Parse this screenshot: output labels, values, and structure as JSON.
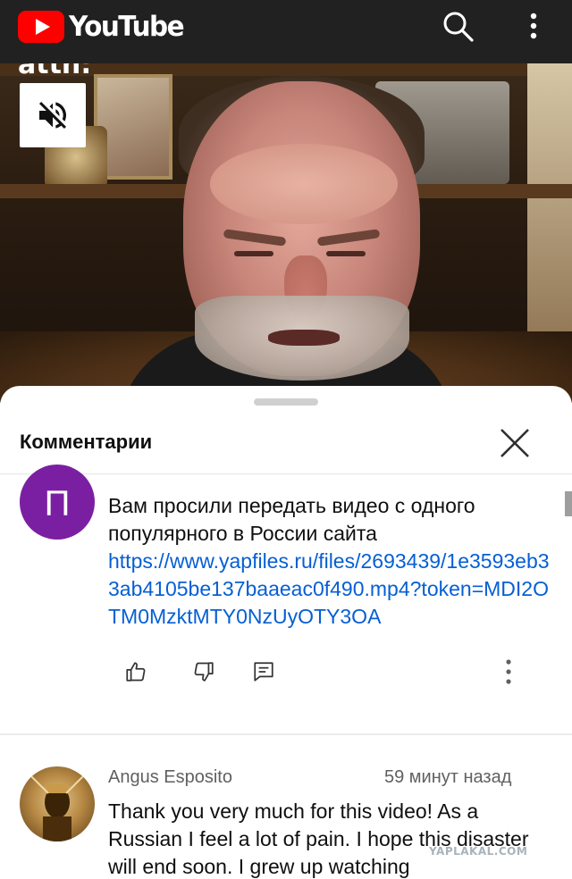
{
  "app": {
    "wordmark": "YouTube",
    "logo_icon": "youtube-play-logo",
    "search_icon": "search-icon",
    "more_icon": "more-vert-icon",
    "bar_color": "#212121",
    "brand_red": "#ff0000"
  },
  "video": {
    "channel_watermark": "attn:",
    "mute_icon": "volume-off-icon"
  },
  "comments_panel": {
    "title": "Комментарии",
    "close_icon": "close-icon",
    "comments": [
      {
        "avatar_letter": "П",
        "avatar_color": "#7b1fa2",
        "text": "Вам просили передать видео с одного популярного в России сайта",
        "link": "https://www.yapfiles.ru/files/2693439/1e3593eb33ab4105be137baaeac0f490.mp4?token=MDI2OTM0MzktMTY0NzUyOTY3OA",
        "actions": [
          "thumb-up-icon",
          "thumb-down-icon",
          "reply-icon",
          "more-vert-icon"
        ]
      },
      {
        "author": "Angus Esposito",
        "time": "59 минут назад",
        "text": "Thank you very much for this video! As a Russian I feel a lot of pain. I hope this disaster will end soon. I grew up watching"
      }
    ],
    "link_color": "#065fd4"
  },
  "watermark": "YAPLAKAL.COM"
}
